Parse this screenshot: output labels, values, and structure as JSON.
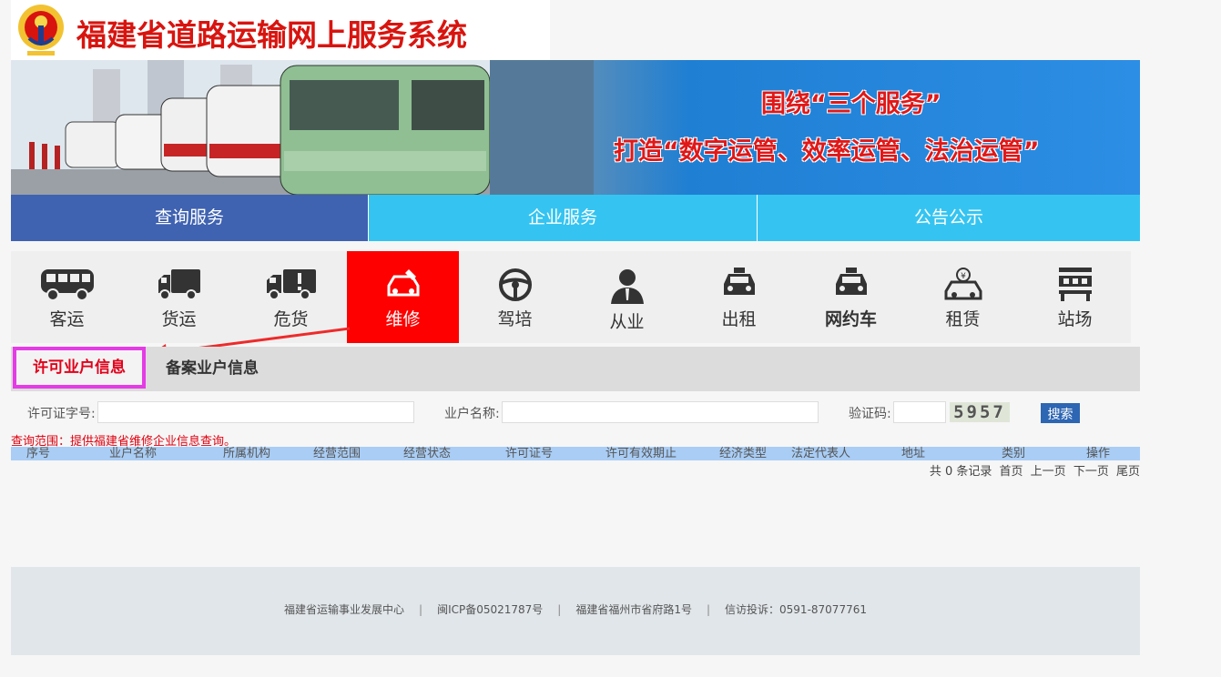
{
  "header": {
    "site_title": "福建省道路运输网上服务系统"
  },
  "banner": {
    "slogan_line1": "围绕“三个服务”",
    "slogan_line2": "打造“数字运管、效率运管、法治运管”"
  },
  "main_nav": [
    {
      "label": "查询服务",
      "active": true
    },
    {
      "label": "企业服务",
      "active": false
    },
    {
      "label": "公告公示",
      "active": false
    }
  ],
  "categories": [
    {
      "label": "客运",
      "icon": "bus-icon"
    },
    {
      "label": "货运",
      "icon": "truck-icon"
    },
    {
      "label": "危货",
      "icon": "hazmat-truck-icon"
    },
    {
      "label": "维修",
      "icon": "car-repair-icon",
      "active": true
    },
    {
      "label": "驾培",
      "icon": "steering-wheel-icon"
    },
    {
      "label": "从业",
      "icon": "person-icon"
    },
    {
      "label": "出租",
      "icon": "taxi-icon"
    },
    {
      "label": "网约车",
      "icon": "ride-hailing-icon"
    },
    {
      "label": "租赁",
      "icon": "car-rental-icon"
    },
    {
      "label": "站场",
      "icon": "station-icon"
    }
  ],
  "sub_tabs": [
    {
      "label": "许可业户信息",
      "active": true
    },
    {
      "label": "备案业户信息",
      "active": false
    }
  ],
  "search": {
    "license_label": "许可证字号:",
    "license_value": "",
    "name_label": "业户名称:",
    "name_value": "",
    "captcha_label": "验证码:",
    "captcha_value": "",
    "captcha_image_text": "5957",
    "search_button": "搜索"
  },
  "scope_note": "查询范围：提供福建省维修企业信息查询。",
  "table": {
    "columns": [
      "序号",
      "业户名称",
      "所属机构",
      "经营范围",
      "经营状态",
      "许可证号",
      "许可有效期止",
      "经济类型",
      "法定代表人",
      "地址",
      "类别",
      "操作"
    ],
    "rows": []
  },
  "pager": {
    "count_text": "共 0 条记录",
    "first": "首页",
    "prev": "上一页",
    "next": "下一页",
    "last": "尾页"
  },
  "footer": {
    "org": "福建省运输事业发展中心",
    "icp": "闽ICP备05021787号",
    "address": "福建省福州市省府路1号",
    "complaint": "信访投诉：0591-87077761"
  },
  "colors": {
    "brand_red": "#d8140f",
    "nav_active": "#3f62b1",
    "nav_inactive": "#35c4f1",
    "category_active": "#fe0000",
    "highlight_border": "#e53be6",
    "search_button": "#2d66b3",
    "table_header": "#a9cdf5"
  }
}
